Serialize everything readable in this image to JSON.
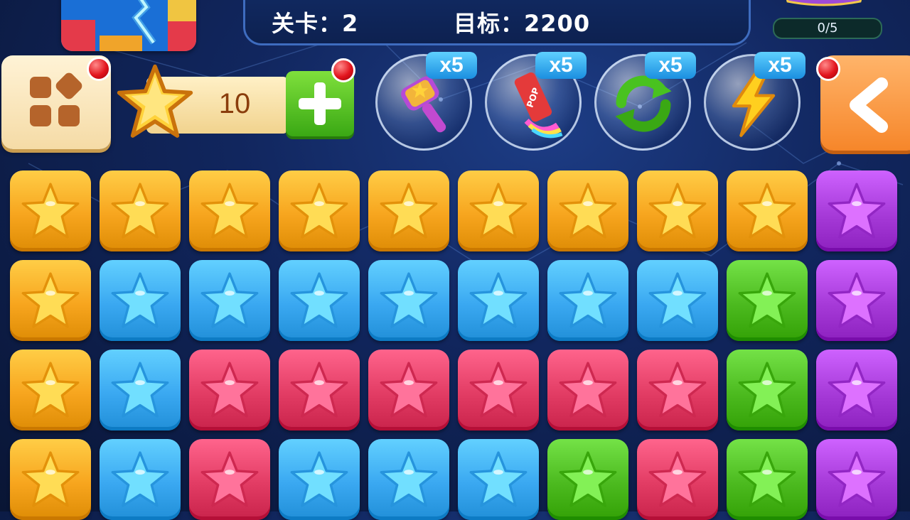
{
  "hud": {
    "level_label": "关卡：",
    "level_value": "2",
    "target_label": "目标：",
    "target_value": "2200",
    "progress": "0/5"
  },
  "stars": {
    "count": "10"
  },
  "tools": [
    {
      "name": "hammer-icon",
      "badge": "x5"
    },
    {
      "name": "pop-crayon-icon",
      "badge": "x5"
    },
    {
      "name": "shuffle-icon",
      "badge": "x5"
    },
    {
      "name": "lightning-icon",
      "badge": "x5"
    }
  ],
  "board": {
    "colors": {
      "O": "#f7a51e",
      "B": "#3aa8f1",
      "R": "#e23c64",
      "G": "#4cba1f",
      "P": "#a63ad8"
    },
    "rows": [
      [
        "O",
        "O",
        "O",
        "O",
        "O",
        "O",
        "O",
        "O",
        "O",
        "P"
      ],
      [
        "O",
        "B",
        "B",
        "B",
        "B",
        "B",
        "B",
        "B",
        "G",
        "P"
      ],
      [
        "O",
        "B",
        "R",
        "R",
        "R",
        "R",
        "R",
        "R",
        "G",
        "P"
      ],
      [
        "O",
        "B",
        "R",
        "B",
        "B",
        "B",
        "G",
        "R",
        "G",
        "P"
      ]
    ]
  }
}
